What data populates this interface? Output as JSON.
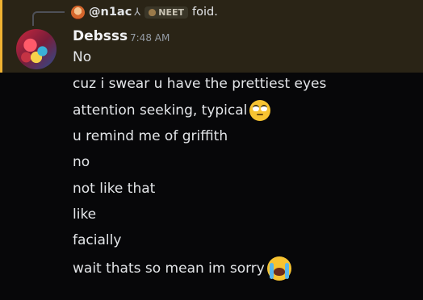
{
  "reply": {
    "author": "@n1ac",
    "icon": "scythe-icon",
    "tag": "NEET",
    "text": "foid."
  },
  "message": {
    "author": "Debsss",
    "timestamp": "7:48 AM",
    "lines": [
      "No",
      "cuz i swear u have the prettiest eyes",
      "attention seeking, typical",
      "u remind me of griffith",
      "no",
      "not like that",
      "like",
      "facially",
      "wait thats so mean im sorry"
    ],
    "emojis": {
      "line_2": "face-with-rolling-eyes",
      "line_8": "loudly-crying-face"
    }
  },
  "colors": {
    "mention_highlight": "#2a2416",
    "mention_bar": "#f0b232",
    "background": "#070709"
  }
}
